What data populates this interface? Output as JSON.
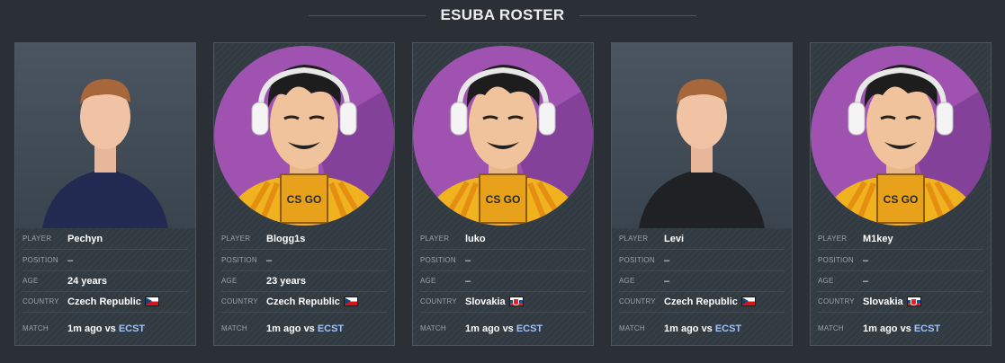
{
  "header": {
    "title": "ESUBA ROSTER"
  },
  "labels": {
    "player": "PLAYER",
    "position": "POSITION",
    "age": "AGE",
    "country": "COUNTRY",
    "match": "MATCH"
  },
  "players": [
    {
      "name": "Pechyn",
      "position": "–",
      "age": "24 years",
      "country": "Czech Republic",
      "flag": "cz-flag-icon",
      "match_text": "1m ago vs",
      "match_team": "ECST",
      "photo": "player-photo"
    },
    {
      "name": "Blogg1s",
      "position": "–",
      "age": "23 years",
      "country": "Czech Republic",
      "flag": "cz-flag-icon",
      "match_text": "1m ago vs",
      "match_team": "ECST",
      "photo": "default-avatar-icon"
    },
    {
      "name": "luko",
      "position": "–",
      "age": "–",
      "country": "Slovakia",
      "flag": "sk-flag-icon",
      "match_text": "1m ago vs",
      "match_team": "ECST",
      "photo": "default-avatar-icon"
    },
    {
      "name": "Levi",
      "position": "–",
      "age": "–",
      "country": "Czech Republic",
      "flag": "cz-flag-icon",
      "match_text": "1m ago vs",
      "match_team": "ECST",
      "photo": "player-photo"
    },
    {
      "name": "M1key",
      "position": "–",
      "age": "–",
      "country": "Slovakia",
      "flag": "sk-flag-icon",
      "match_text": "1m ago vs",
      "match_team": "ECST",
      "photo": "default-avatar-icon"
    }
  ],
  "colors": {
    "background": "#2a3036",
    "card": "#323a42",
    "avatar_purple": "#9f52b0",
    "link": "#9fc3ff"
  }
}
